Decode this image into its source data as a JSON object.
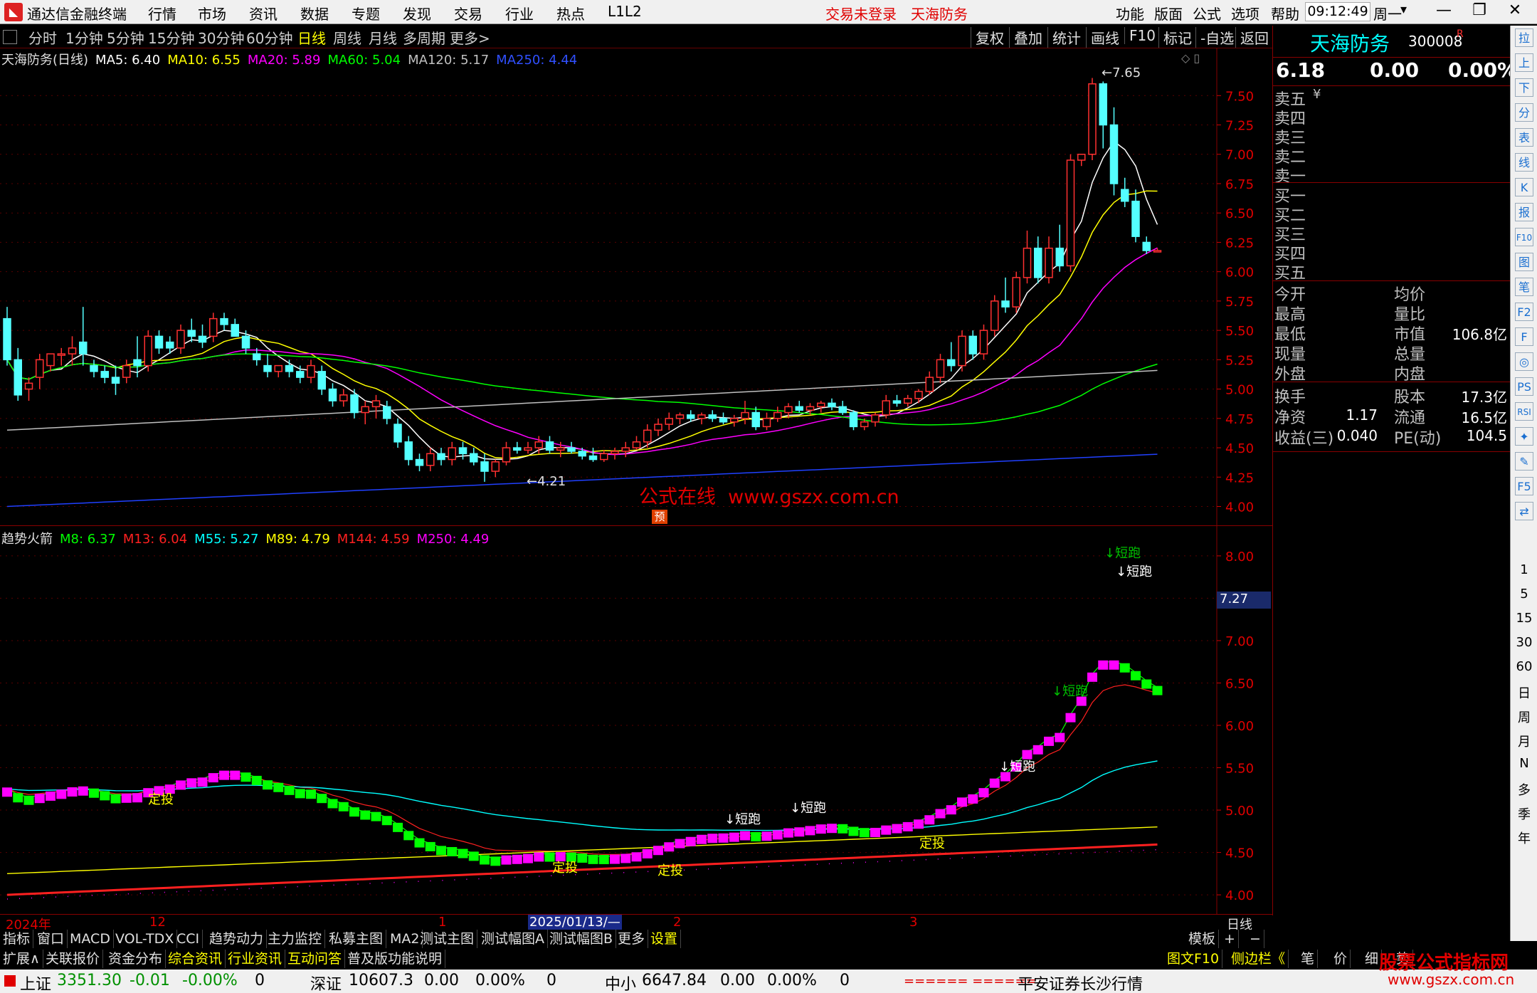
{
  "app": {
    "name": "通达信金融终端",
    "menu": [
      "行情",
      "市场",
      "资讯",
      "数据",
      "专题",
      "发现",
      "交易",
      "行业",
      "热点",
      "L1L2"
    ],
    "notice": "交易未登录",
    "stock_name_top": "天海防务",
    "right_menu": [
      "功能",
      "版面",
      "公式",
      "选项",
      "帮助"
    ],
    "time": "09:12:49",
    "weekday": "周一"
  },
  "periods": [
    "分时",
    "1分钟",
    "5分钟",
    "15分钟",
    "30分钟",
    "60分钟",
    "日线",
    "周线",
    "月线",
    "多周期",
    "更多>"
  ],
  "active_period": "日线",
  "tools": [
    "复权",
    "叠加",
    "统计",
    "画线",
    "F10",
    "标记",
    "-自选",
    "返回"
  ],
  "main_legend": {
    "title": "天海防务(日线)",
    "items": [
      {
        "label": "MA5: 6.40",
        "color": "#ffffff"
      },
      {
        "label": "MA10: 6.55",
        "color": "#ffff00"
      },
      {
        "label": "MA20: 5.89",
        "color": "#ff00ff"
      },
      {
        "label": "MA60: 5.04",
        "color": "#00ff00"
      },
      {
        "label": "MA120: 5.17",
        "color": "#c0c0c0"
      },
      {
        "label": "MA250: 4.44",
        "color": "#3050ff"
      }
    ]
  },
  "main_axis": [
    "7.50",
    "7.25",
    "7.00",
    "6.75",
    "6.50",
    "6.25",
    "6.00",
    "5.75",
    "5.50",
    "5.25",
    "5.00",
    "4.75",
    "4.50",
    "4.25",
    "4.00"
  ],
  "annotations": {
    "high": "7.65",
    "low": "4.21",
    "watermark": "公式在线",
    "watermark_url": "www.gszx.com.cn",
    "pre_badge": "预"
  },
  "ind_legend": {
    "title": "趋势火箭",
    "items": [
      {
        "label": "M8: 6.37",
        "color": "#00ff00"
      },
      {
        "label": "M13: 6.04",
        "color": "#ff2020"
      },
      {
        "label": "M55: 5.27",
        "color": "#00ffff"
      },
      {
        "label": "M89: 4.79",
        "color": "#ffff00"
      },
      {
        "label": "M144: 4.59",
        "color": "#ff2020"
      },
      {
        "label": "M250: 4.49",
        "color": "#ff00ff"
      }
    ]
  },
  "ind_axis": [
    "8.00",
    "7.50",
    "7.00",
    "6.50",
    "6.00",
    "5.50",
    "5.00",
    "4.50",
    "4.00"
  ],
  "ind_cursor_value": "7.27",
  "signals": {
    "dingtou": "定投",
    "duanpao": "↓短跑"
  },
  "date_axis": [
    "2024年",
    "12",
    "1",
    "2025/01/13/—",
    "2",
    "3"
  ],
  "date_axis_right": "日线",
  "quote": {
    "name": "天海防务",
    "code": "300008",
    "badge": "R",
    "price": "6.18",
    "change": "0.00",
    "pct": "0.00%",
    "asks": [
      "卖五",
      "卖四",
      "卖三",
      "卖二",
      "卖一"
    ],
    "ask_unit": "¥",
    "bids": [
      "买一",
      "买二",
      "买三",
      "买四",
      "买五"
    ],
    "stats_left": [
      "今开",
      "最高",
      "最低",
      "现量",
      "外盘"
    ],
    "stats_right": [
      "均价",
      "量比",
      "市值",
      "总量",
      "内盘"
    ],
    "market_value": "106.8亿",
    "fin_rows": [
      {
        "l": "换手",
        "lv": "",
        "r": "股本",
        "rv": "17.3亿"
      },
      {
        "l": "净资",
        "lv": "1.17",
        "r": "流通",
        "rv": "16.5亿"
      },
      {
        "l": "收益(三)",
        "lv": "0.040",
        "r": "PE(动)",
        "rv": "104.5"
      }
    ]
  },
  "side_icons": [
    "拉",
    "上",
    "下",
    "分",
    "表",
    "线",
    "K",
    "报",
    "F10",
    "图",
    "笔",
    "F2",
    "F",
    "◎",
    "PS",
    "RSI",
    "✦",
    "✎",
    "F5",
    "⇄"
  ],
  "side_periods": [
    "1",
    "5",
    "15",
    "30",
    "60",
    "日",
    "周",
    "月",
    "N",
    "多",
    "季",
    "年"
  ],
  "bottom_tabs": [
    "指标",
    "窗口",
    "MACD",
    "VOL-TDX",
    "CCI",
    "趋势动力",
    "主力监控",
    "私募主图",
    "MA2",
    "测试主图",
    "测试幅图A",
    "测试幅图B",
    "更多",
    "设置"
  ],
  "bottom_right": [
    "模板",
    "+",
    "−"
  ],
  "info_tabs": [
    {
      "label": "扩展∧",
      "color": "#e0e0e0"
    },
    {
      "label": "关联报价",
      "color": "#e0e0e0"
    },
    {
      "label": "资金分布",
      "color": "#e0e0e0"
    },
    {
      "label": "综合资讯",
      "color": "#ffff00"
    },
    {
      "label": "行业资讯",
      "color": "#ffff00"
    },
    {
      "label": "互动问答",
      "color": "#ffff00"
    },
    {
      "label": "普及版功能说明",
      "color": "#e0e0e0"
    }
  ],
  "info_right": [
    "图文F10",
    "侧边栏《",
    "笔",
    "价",
    "细",
    "势"
  ],
  "status": {
    "sh_label": "上证",
    "sh_val": "3351.30",
    "sh_chg": "-0.01",
    "sh_pct": "-0.00%",
    "sh_vol": "0",
    "sz_label": "深证",
    "sz_val": "10607.3",
    "sz_chg": "0.00",
    "sz_pct": "0.00%",
    "sz_vol": "0",
    "zx_label": "中小",
    "zx_val": "6647.84",
    "zx_chg": "0.00",
    "zx_pct": "0.00%",
    "zx_vol": "0",
    "bars": "====== ======",
    "broker": "平安证券长沙行情",
    "brand": "股票公式指标网",
    "brand_url": "www.gszx.com.cn"
  },
  "chart_data": {
    "type": "candlestick",
    "y_range": [
      3.9,
      7.72
    ],
    "ohlc": [
      [
        5.6,
        5.7,
        5.2,
        5.25
      ],
      [
        5.25,
        5.35,
        4.9,
        4.95
      ],
      [
        5.0,
        5.1,
        4.9,
        5.05
      ],
      [
        5.1,
        5.3,
        5.0,
        5.25
      ],
      [
        5.2,
        5.3,
        5.15,
        5.3
      ],
      [
        5.3,
        5.35,
        5.2,
        5.3
      ],
      [
        5.3,
        5.45,
        5.2,
        5.35
      ],
      [
        5.4,
        5.7,
        5.2,
        5.3
      ],
      [
        5.2,
        5.25,
        5.1,
        5.15
      ],
      [
        5.15,
        5.2,
        5.05,
        5.1
      ],
      [
        5.1,
        5.2,
        4.95,
        5.05
      ],
      [
        5.1,
        5.25,
        5.05,
        5.2
      ],
      [
        5.25,
        5.45,
        5.1,
        5.2
      ],
      [
        5.2,
        5.5,
        5.15,
        5.45
      ],
      [
        5.45,
        5.5,
        5.3,
        5.35
      ],
      [
        5.4,
        5.45,
        5.3,
        5.35
      ],
      [
        5.35,
        5.55,
        5.3,
        5.5
      ],
      [
        5.5,
        5.6,
        5.4,
        5.45
      ],
      [
        5.45,
        5.55,
        5.35,
        5.4
      ],
      [
        5.45,
        5.65,
        5.4,
        5.6
      ],
      [
        5.6,
        5.65,
        5.5,
        5.55
      ],
      [
        5.55,
        5.6,
        5.45,
        5.45
      ],
      [
        5.45,
        5.5,
        5.3,
        5.35
      ],
      [
        5.3,
        5.35,
        5.2,
        5.25
      ],
      [
        5.2,
        5.3,
        5.1,
        5.15
      ],
      [
        5.15,
        5.2,
        5.1,
        5.2
      ],
      [
        5.2,
        5.25,
        5.1,
        5.15
      ],
      [
        5.15,
        5.2,
        5.05,
        5.1
      ],
      [
        5.1,
        5.25,
        5.05,
        5.2
      ],
      [
        5.15,
        5.2,
        4.95,
        5.0
      ],
      [
        5.0,
        5.05,
        4.85,
        4.9
      ],
      [
        4.9,
        5.0,
        4.85,
        4.95
      ],
      [
        4.95,
        5.0,
        4.75,
        4.8
      ],
      [
        4.8,
        4.9,
        4.7,
        4.85
      ],
      [
        4.85,
        4.95,
        4.75,
        4.9
      ],
      [
        4.85,
        4.9,
        4.7,
        4.75
      ],
      [
        4.7,
        4.75,
        4.5,
        4.55
      ],
      [
        4.55,
        4.6,
        4.35,
        4.4
      ],
      [
        4.4,
        4.45,
        4.3,
        4.35
      ],
      [
        4.35,
        4.5,
        4.3,
        4.45
      ],
      [
        4.45,
        4.5,
        4.35,
        4.4
      ],
      [
        4.4,
        4.55,
        4.35,
        4.5
      ],
      [
        4.5,
        4.55,
        4.4,
        4.45
      ],
      [
        4.45,
        4.5,
        4.35,
        4.38
      ],
      [
        4.38,
        4.45,
        4.21,
        4.3
      ],
      [
        4.3,
        4.4,
        4.25,
        4.38
      ],
      [
        4.38,
        4.55,
        4.35,
        4.5
      ],
      [
        4.5,
        4.55,
        4.45,
        4.48
      ],
      [
        4.48,
        4.55,
        4.45,
        4.5
      ],
      [
        4.5,
        4.6,
        4.45,
        4.55
      ],
      [
        4.55,
        4.6,
        4.45,
        4.48
      ],
      [
        4.48,
        4.55,
        4.42,
        4.5
      ],
      [
        4.5,
        4.55,
        4.45,
        4.47
      ],
      [
        4.47,
        4.5,
        4.4,
        4.43
      ],
      [
        4.43,
        4.5,
        4.38,
        4.4
      ],
      [
        4.4,
        4.48,
        4.38,
        4.45
      ],
      [
        4.45,
        4.5,
        4.4,
        4.47
      ],
      [
        4.47,
        4.55,
        4.42,
        4.5
      ],
      [
        4.5,
        4.6,
        4.48,
        4.55
      ],
      [
        4.55,
        4.7,
        4.5,
        4.65
      ],
      [
        4.65,
        4.75,
        4.6,
        4.7
      ],
      [
        4.7,
        4.8,
        4.65,
        4.75
      ],
      [
        4.75,
        4.8,
        4.7,
        4.78
      ],
      [
        4.78,
        4.82,
        4.72,
        4.75
      ],
      [
        4.75,
        4.8,
        4.7,
        4.78
      ],
      [
        4.78,
        4.82,
        4.72,
        4.75
      ],
      [
        4.75,
        4.8,
        4.7,
        4.72
      ],
      [
        4.72,
        4.78,
        4.68,
        4.75
      ],
      [
        4.75,
        4.9,
        4.7,
        4.8
      ],
      [
        4.8,
        4.85,
        4.65,
        4.68
      ],
      [
        4.68,
        4.8,
        4.65,
        4.75
      ],
      [
        4.75,
        4.85,
        4.72,
        4.8
      ],
      [
        4.8,
        4.88,
        4.75,
        4.85
      ],
      [
        4.85,
        4.9,
        4.8,
        4.82
      ],
      [
        4.82,
        4.88,
        4.78,
        4.85
      ],
      [
        4.85,
        4.9,
        4.8,
        4.88
      ],
      [
        4.88,
        4.92,
        4.82,
        4.85
      ],
      [
        4.85,
        4.9,
        4.78,
        4.8
      ],
      [
        4.8,
        4.82,
        4.65,
        4.68
      ],
      [
        4.68,
        4.75,
        4.65,
        4.72
      ],
      [
        4.72,
        4.8,
        4.68,
        4.78
      ],
      [
        4.78,
        4.95,
        4.75,
        4.9
      ],
      [
        4.9,
        4.95,
        4.85,
        4.88
      ],
      [
        4.88,
        4.95,
        4.85,
        4.92
      ],
      [
        4.92,
        5.0,
        4.88,
        4.98
      ],
      [
        4.98,
        5.15,
        4.95,
        5.1
      ],
      [
        5.1,
        5.3,
        5.05,
        5.25
      ],
      [
        5.25,
        5.4,
        5.15,
        5.2
      ],
      [
        5.2,
        5.5,
        5.15,
        5.45
      ],
      [
        5.45,
        5.5,
        5.25,
        5.3
      ],
      [
        5.3,
        5.55,
        5.25,
        5.5
      ],
      [
        5.5,
        5.8,
        5.45,
        5.75
      ],
      [
        5.75,
        5.95,
        5.65,
        5.7
      ],
      [
        5.7,
        6.0,
        5.65,
        5.95
      ],
      [
        5.95,
        6.35,
        5.9,
        6.2
      ],
      [
        6.2,
        6.3,
        5.9,
        5.95
      ],
      [
        5.95,
        6.3,
        5.9,
        6.2
      ],
      [
        6.2,
        6.4,
        6.0,
        6.05
      ],
      [
        6.05,
        7.0,
        6.0,
        6.95
      ],
      [
        6.95,
        7.0,
        6.9,
        7.0
      ],
      [
        7.0,
        7.65,
        6.95,
        7.6
      ],
      [
        7.6,
        7.62,
        7.05,
        7.25
      ],
      [
        7.25,
        7.4,
        6.65,
        6.75
      ],
      [
        6.7,
        6.8,
        6.55,
        6.6
      ],
      [
        6.6,
        6.7,
        6.25,
        6.3
      ],
      [
        6.25,
        6.3,
        6.15,
        6.18
      ],
      [
        6.18,
        6.2,
        6.18,
        6.18
      ]
    ]
  }
}
